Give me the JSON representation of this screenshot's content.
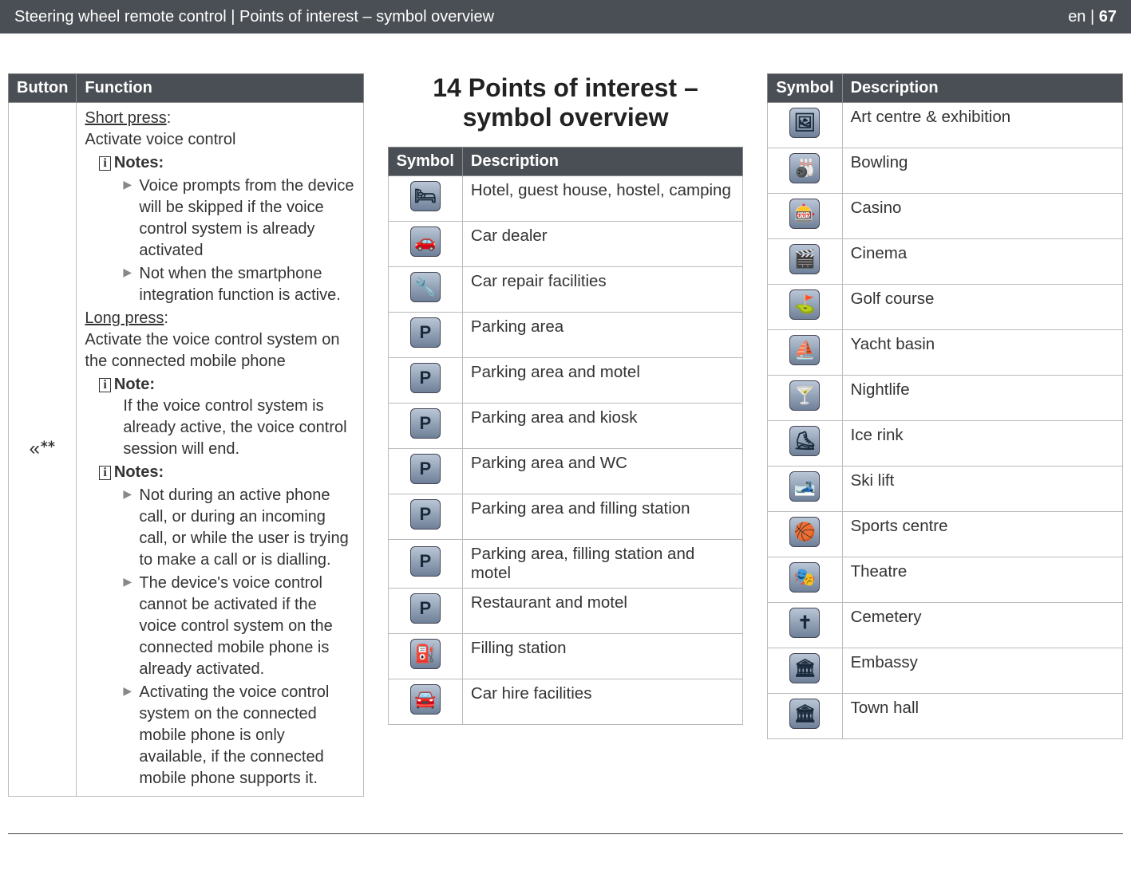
{
  "header": {
    "title": "Steering wheel remote control | Points of interest – symbol overview",
    "lang": "en",
    "page": "67"
  },
  "left": {
    "th_button": "Button",
    "th_function": "Function",
    "short_press_label": "Short press",
    "short_press_desc": "Activate voice control",
    "notes1_label": "Notes:",
    "notes1": [
      "Voice prompts from the device will be skipped if the voice control system is already activated",
      "Not when the smartphone integration function is active."
    ],
    "long_press_label": "Long press",
    "long_press_desc": "Activate the voice control system on the connected mobile phone",
    "note_label": "Note:",
    "note_text": "If the voice control system is already active, the voice control session will end.",
    "notes2_label": "Notes:",
    "notes2": [
      "Not during an active phone call, or during an incoming call, or while the user is trying to make a call or is dialling.",
      "The device's voice control cannot be activated if the voice control system on the connected mobile phone is already activated.",
      "Activating the voice control system on the connected mobile phone is only available, if the connected mobile phone supports it."
    ]
  },
  "middle": {
    "heading": "14 Points of interest – symbol overview",
    "th_symbol": "Symbol",
    "th_desc": "Description",
    "rows": [
      {
        "glyph": "🛏",
        "desc": "Hotel, guest house, hostel, camping"
      },
      {
        "glyph": "🚗",
        "desc": "Car dealer"
      },
      {
        "glyph": "🔧",
        "desc": "Car repair facilities"
      },
      {
        "glyph": "P",
        "desc": "Parking area"
      },
      {
        "glyph": "P",
        "desc": "Parking area and motel"
      },
      {
        "glyph": "P",
        "desc": "Parking area and kiosk"
      },
      {
        "glyph": "P",
        "desc": "Parking area and WC"
      },
      {
        "glyph": "P",
        "desc": "Parking area and filling station"
      },
      {
        "glyph": "P",
        "desc": "Parking area, filling station and motel"
      },
      {
        "glyph": "P",
        "desc": "Restaurant and motel"
      },
      {
        "glyph": "⛽",
        "desc": "Filling station"
      },
      {
        "glyph": "🚘",
        "desc": "Car hire facilities"
      }
    ]
  },
  "right": {
    "th_symbol": "Symbol",
    "th_desc": "Description",
    "rows": [
      {
        "glyph": "🖼",
        "desc": "Art centre & exhibition"
      },
      {
        "glyph": "🎳",
        "desc": "Bowling"
      },
      {
        "glyph": "🎰",
        "desc": "Casino"
      },
      {
        "glyph": "🎬",
        "desc": "Cinema"
      },
      {
        "glyph": "⛳",
        "desc": "Golf course"
      },
      {
        "glyph": "⛵",
        "desc": "Yacht basin"
      },
      {
        "glyph": "🍸",
        "desc": "Nightlife"
      },
      {
        "glyph": "⛸",
        "desc": "Ice rink"
      },
      {
        "glyph": "🎿",
        "desc": "Ski lift"
      },
      {
        "glyph": "🏀",
        "desc": "Sports centre"
      },
      {
        "glyph": "🎭",
        "desc": "Theatre"
      },
      {
        "glyph": "✝",
        "desc": "Cemetery"
      },
      {
        "glyph": "🏛",
        "desc": "Embassy"
      },
      {
        "glyph": "🏛",
        "desc": "Town hall"
      }
    ]
  }
}
